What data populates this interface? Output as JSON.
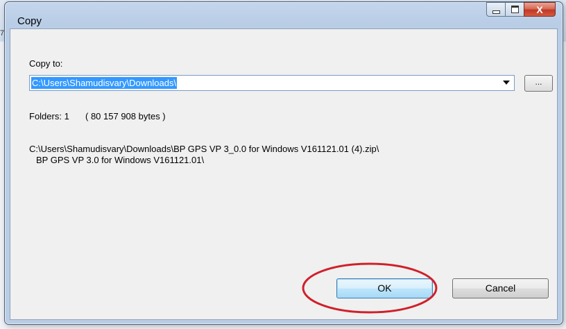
{
  "dialog": {
    "title": "Copy",
    "copy_to_label": "Copy to:",
    "destination_path": "C:\\Users\\Shamudisvary\\Downloads\\",
    "browse_label": "...",
    "folders_text": "Folders: 1",
    "bytes_text": "( 80 157 908 bytes )",
    "source_line_1": "C:\\Users\\Shamudisvary\\Downloads\\BP GPS VP 3_0.0 for Windows V161121.01 (4).zip\\",
    "source_line_2": "BP GPS VP 3.0 for Windows V161121.01\\",
    "ok_label": "OK",
    "cancel_label": "Cancel",
    "close_glyph": "X"
  },
  "background": {
    "edge_digit": "7"
  },
  "annotation": {
    "highlight_color": "#d0202a"
  }
}
